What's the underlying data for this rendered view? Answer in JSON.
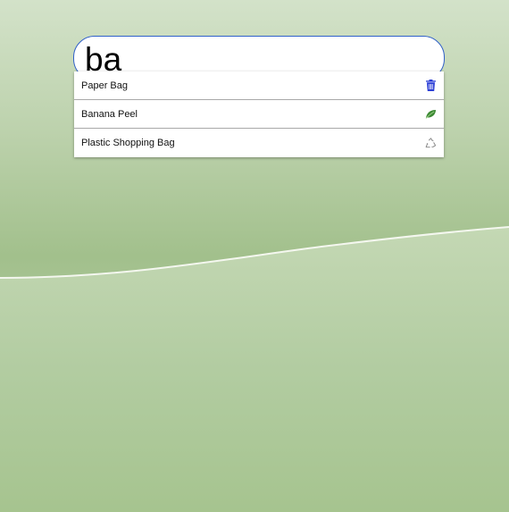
{
  "search": {
    "value": "ba",
    "accent_color": "#3060c8"
  },
  "suggestions": [
    {
      "label": "Paper Bag",
      "icon": "trash-icon",
      "icon_color": "#2c3fd6"
    },
    {
      "label": "Banana Peel",
      "icon": "leaf-icon",
      "icon_color": "#3d8a35"
    },
    {
      "label": "Plastic Shopping Bag",
      "icon": "recycle-icon",
      "icon_color": "#888888"
    }
  ]
}
